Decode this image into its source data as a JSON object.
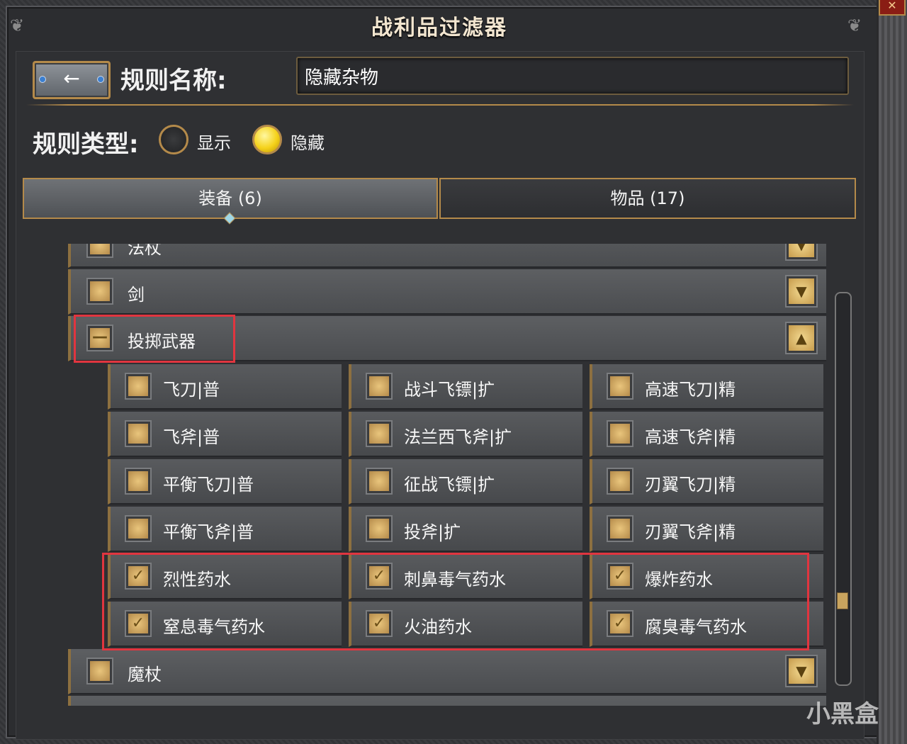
{
  "window": {
    "title": "战利品过滤器",
    "close_icon": "close-icon"
  },
  "header": {
    "back_icon": "arrow-left-icon",
    "rule_name_label": "规则名称:",
    "rule_name_value": "隐藏杂物",
    "rule_type_label": "规则类型:",
    "rule_types": [
      {
        "label": "显示",
        "selected": false
      },
      {
        "label": "隐藏",
        "selected": true
      }
    ]
  },
  "tabs": [
    {
      "label": "装备 (6)",
      "active": true
    },
    {
      "label": "物品 (17)",
      "active": false
    }
  ],
  "list": {
    "partial_top": "法杖",
    "categories": [
      {
        "label": "剑",
        "state": "unchecked",
        "expanded": false
      },
      {
        "label": "投掷武器",
        "state": "partial",
        "expanded": true
      },
      {
        "label": "魔杖",
        "state": "unchecked",
        "expanded": false
      }
    ],
    "throwing_items": [
      [
        {
          "label": "飞刀|普",
          "checked": false
        },
        {
          "label": "战斗飞镖|扩",
          "checked": false
        },
        {
          "label": "高速飞刀|精",
          "checked": false
        }
      ],
      [
        {
          "label": "飞斧|普",
          "checked": false
        },
        {
          "label": "法兰西飞斧|扩",
          "checked": false
        },
        {
          "label": "高速飞斧|精",
          "checked": false
        }
      ],
      [
        {
          "label": "平衡飞刀|普",
          "checked": false
        },
        {
          "label": "征战飞镖|扩",
          "checked": false
        },
        {
          "label": "刃翼飞刀|精",
          "checked": false
        }
      ],
      [
        {
          "label": "平衡飞斧|普",
          "checked": false
        },
        {
          "label": "投斧|扩",
          "checked": false
        },
        {
          "label": "刃翼飞斧|精",
          "checked": false
        }
      ],
      [
        {
          "label": "烈性药水",
          "checked": true
        },
        {
          "label": "刺鼻毒气药水",
          "checked": true
        },
        {
          "label": "爆炸药水",
          "checked": true
        }
      ],
      [
        {
          "label": "窒息毒气药水",
          "checked": true
        },
        {
          "label": "火油药水",
          "checked": true
        },
        {
          "label": "腐臭毒气药水",
          "checked": true
        }
      ]
    ]
  },
  "watermark": "小黑盒",
  "colors": {
    "gold": "#b48a4a",
    "highlight": "#e1353f",
    "radio_on": "#f5d21a"
  }
}
